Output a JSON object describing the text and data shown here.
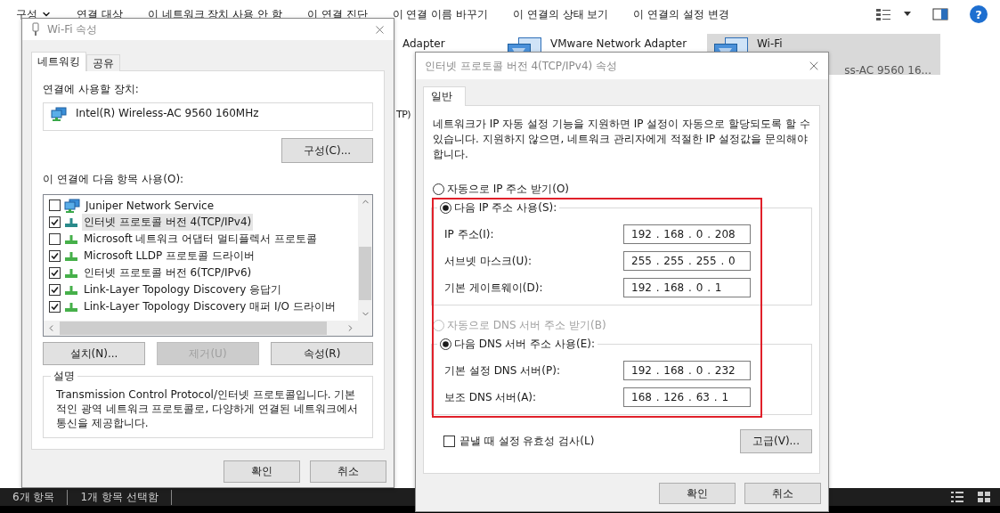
{
  "explorer": {
    "toolbar": [
      {
        "label": "구성",
        "kind": "menu"
      },
      {
        "label": "연결 대상",
        "kind": "action"
      },
      {
        "label": "이 네트워크 장치 사용 안 함",
        "kind": "action"
      },
      {
        "label": "이 연결 진단",
        "kind": "action"
      },
      {
        "label": "이 연결 이름 바꾸기",
        "kind": "action"
      },
      {
        "label": "이 연결의 상태 보기",
        "kind": "action"
      },
      {
        "label": "이 연결의 설정 변경",
        "kind": "action"
      }
    ],
    "adapter_rows": [
      [
        {
          "kind": "cut",
          "name": "Adapter",
          "selected": false
        },
        {
          "kind": "tile",
          "name": "VMware Network Adapter",
          "selected": false
        },
        {
          "kind": "tile",
          "name": "Wi-Fi",
          "detail": "ss-AC 9560 16...",
          "selected": true
        }
      ],
      [
        {
          "kind": "cut",
          "name": "TP)",
          "selected": false
        }
      ]
    ],
    "status_bar": [
      "6개 항목",
      "1개 항목 선택함"
    ],
    "help_label": "?"
  },
  "wifi_dialog": {
    "title": "Wi-Fi 속성",
    "tabs": [
      {
        "label": "네트워킹",
        "selected": true
      },
      {
        "label": "공유",
        "selected": false
      }
    ],
    "device_label": "연결에 사용할 장치:",
    "device": "Intel(R) Wireless-AC 9560 160MHz",
    "configure_button": "구성(C)...",
    "items_label": "이 연결에 다음 항목 사용(O):",
    "items": [
      {
        "label": "Juniper Network Service",
        "checked": false,
        "selected": false,
        "kind": "service"
      },
      {
        "label": "인터넷 프로토콜 버전 4(TCP/IPv4)",
        "checked": true,
        "selected": true,
        "kind": "protocol"
      },
      {
        "label": "Microsoft 네트워크 어댑터 멀티플렉서 프로토콜",
        "checked": false,
        "selected": false,
        "kind": "protocol"
      },
      {
        "label": "Microsoft LLDP 프로토콜 드라이버",
        "checked": true,
        "selected": false,
        "kind": "protocol"
      },
      {
        "label": "인터넷 프로토콜 버전 6(TCP/IPv6)",
        "checked": true,
        "selected": false,
        "kind": "protocol"
      },
      {
        "label": "Link-Layer Topology Discovery 응답기",
        "checked": true,
        "selected": false,
        "kind": "protocol"
      },
      {
        "label": "Link-Layer Topology Discovery 매퍼 I/O 드라이버",
        "checked": true,
        "selected": false,
        "kind": "protocol"
      }
    ],
    "buttons": [
      {
        "label": "설치(N)...",
        "disabled": false
      },
      {
        "label": "제거(U)",
        "disabled": true
      },
      {
        "label": "속성(R)",
        "disabled": false
      }
    ],
    "description_title": "설명",
    "description": "Transmission Control Protocol/인터넷 프로토콜입니다. 기본적인 광역 네트워크 프로토콜로, 다양하게 연결된 네트워크에서 통신을 제공합니다.",
    "ok": "확인",
    "cancel": "취소"
  },
  "ipv4_dialog": {
    "title": "인터넷 프로토콜 버전 4(TCP/IPv4) 속성",
    "tabs": [
      {
        "label": "일반",
        "selected": true
      }
    ],
    "intro": "네트워크가 IP 자동 설정 기능을 지원하면 IP 설정이 자동으로 할당되도록 할 수 있습니다. 지원하지 않으면, 네트워크 관리자에게 적절한 IP 설정값을 문의해야 합니다.",
    "ip_options": [
      {
        "label": "자동으로 IP 주소 받기(O)",
        "selected": false,
        "disabled": false
      },
      {
        "label": "다음 IP 주소 사용(S):",
        "selected": true,
        "disabled": false
      }
    ],
    "ip_fields": [
      {
        "label": "IP 주소(I):",
        "value": "192 . 168 . 0 . 208"
      },
      {
        "label": "서브넷 마스크(U):",
        "value": "255 . 255 . 255 . 0"
      },
      {
        "label": "기본 게이트웨이(D):",
        "value": "192 . 168 . 0 . 1"
      }
    ],
    "dns_options": [
      {
        "label": "자동으로 DNS 서버 주소 받기(B)",
        "selected": false,
        "disabled": true
      },
      {
        "label": "다음 DNS 서버 주소 사용(E):",
        "selected": true,
        "disabled": false
      }
    ],
    "dns_fields": [
      {
        "label": "기본 설정 DNS 서버(P):",
        "value": "192 . 168 . 0 . 232"
      },
      {
        "label": "보조 DNS 서버(A):",
        "value": "168 . 126 . 63 . 1"
      }
    ],
    "validate": {
      "label": "끝낼 때 설정 유효성 검사(L)",
      "checked": false
    },
    "advanced_button": "고급(V)...",
    "ok": "확인",
    "cancel": "취소"
  }
}
